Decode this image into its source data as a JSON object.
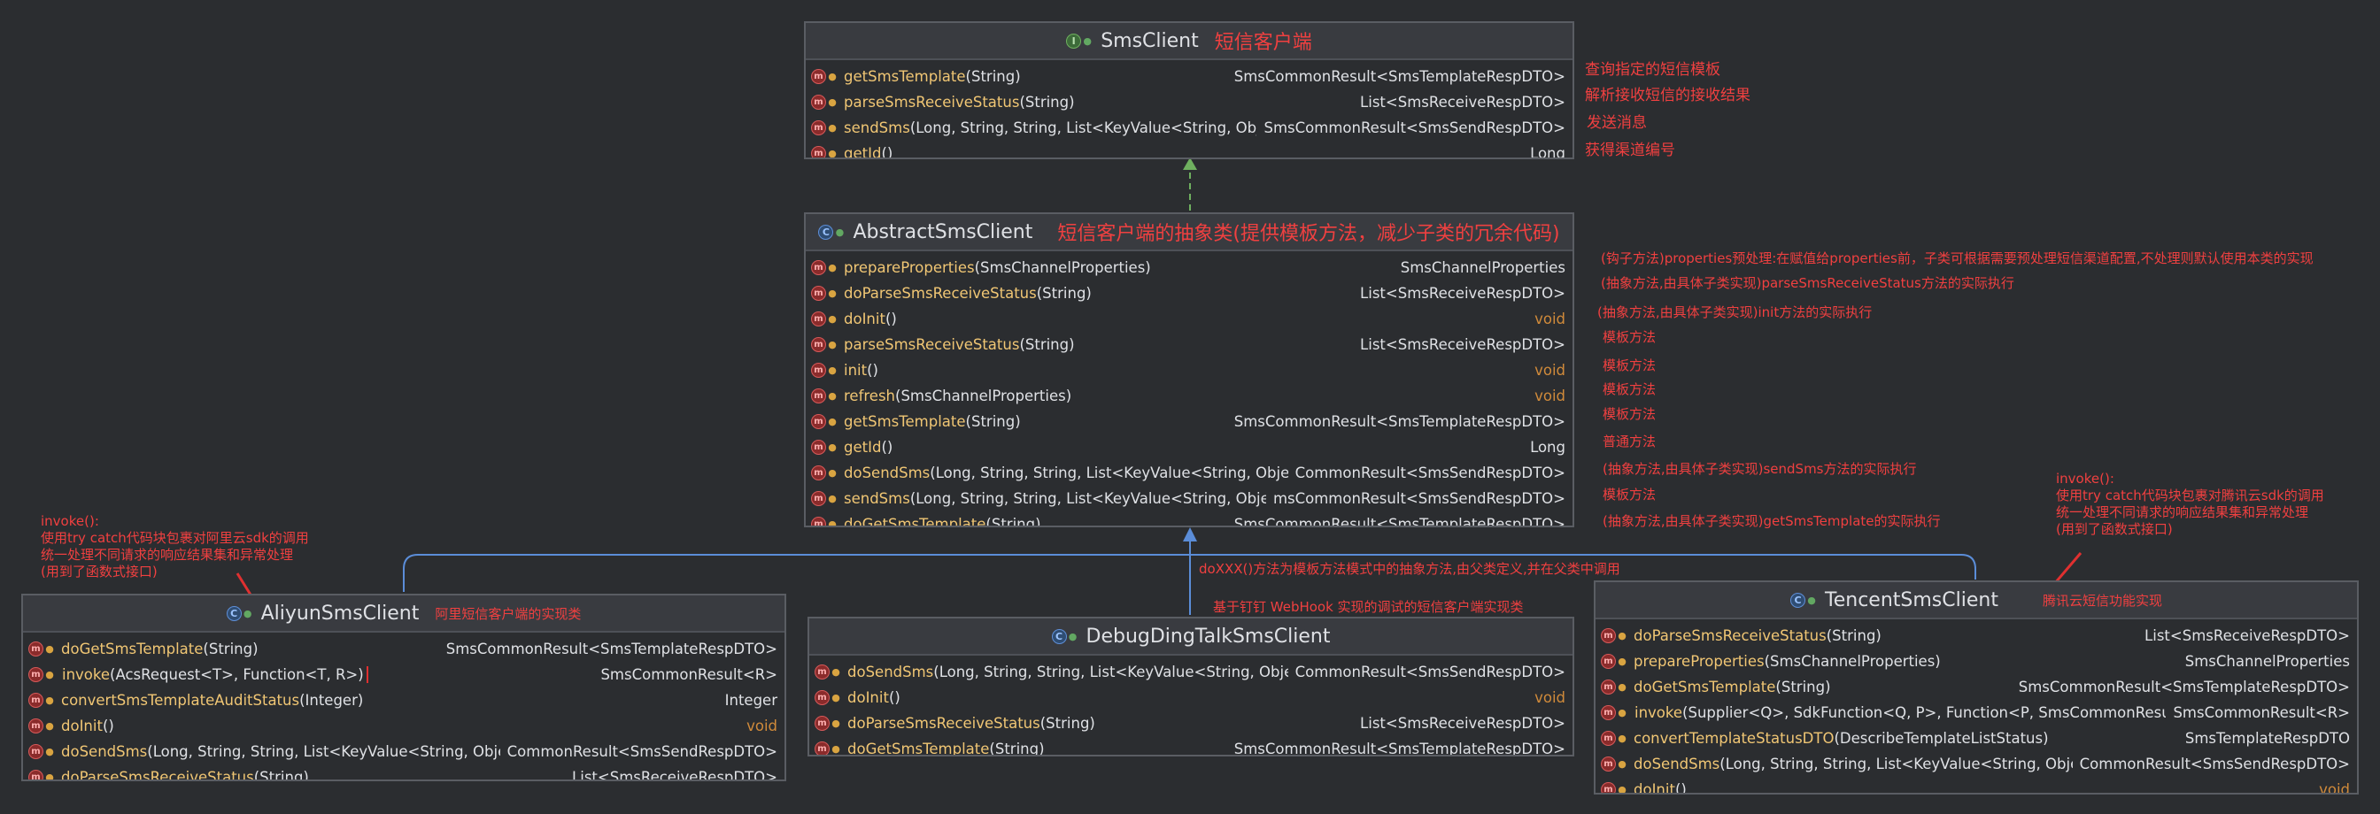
{
  "sms_client": {
    "name": "SmsClient",
    "note": "短信客户端",
    "methods": [
      {
        "name": "getSmsTemplate",
        "params": "(String)",
        "ret": "SmsCommonResult<SmsTemplateRespDTO>",
        "note": "查询指定的短信模板"
      },
      {
        "name": "parseSmsReceiveStatus",
        "params": "(String)",
        "ret": "List<SmsReceiveRespDTO>",
        "note": "解析接收短信的接收结果"
      },
      {
        "name": "sendSms",
        "params": "(Long, String, String, List<KeyValue<String, Object>>)",
        "ret": "SmsCommonResult<SmsSendRespDTO>",
        "note": "发送消息"
      },
      {
        "name": "getId",
        "params": "()",
        "ret": "Long",
        "note": "获得渠道编号"
      }
    ]
  },
  "abstract_client": {
    "name": "AbstractSmsClient",
    "note": "短信客户端的抽象类(提供模板方法，减少子类的冗余代码)",
    "methods": [
      {
        "name": "prepareProperties",
        "params": "(SmsChannelProperties)",
        "ret": "SmsChannelProperties",
        "note": "(钩子方法)properties预处理:在赋值给properties前，子类可根据需要预处理短信渠道配置,不处理则默认使用本类的实现"
      },
      {
        "name": "doParseSmsReceiveStatus",
        "params": "(String)",
        "ret": "List<SmsReceiveRespDTO>",
        "note": "(抽象方法,由具体子类实现)parseSmsReceiveStatus方法的实际执行"
      },
      {
        "name": "doInit",
        "params": "()",
        "ret": "void",
        "note": "(抽象方法,由具体子类实现)init方法的实际执行"
      },
      {
        "name": "parseSmsReceiveStatus",
        "params": "(String)",
        "ret": "List<SmsReceiveRespDTO>",
        "note": "模板方法"
      },
      {
        "name": "init",
        "params": "()",
        "ret": "void",
        "note": "模板方法"
      },
      {
        "name": "refresh",
        "params": "(SmsChannelProperties)",
        "ret": "void",
        "note": "模板方法"
      },
      {
        "name": "getSmsTemplate",
        "params": "(String)",
        "ret": "SmsCommonResult<SmsTemplateRespDTO>",
        "note": "模板方法"
      },
      {
        "name": "getId",
        "params": "()",
        "ret": "Long",
        "note": "普通方法"
      },
      {
        "name": "doSendSms",
        "params": "(Long, String, String, List<KeyValue<String, Object>>)",
        "ret": "CommonResult<SmsSendRespDTO>",
        "note": "(抽象方法,由具体子类实现)sendSms方法的实际执行"
      },
      {
        "name": "sendSms",
        "params": "(Long, String, String, List<KeyValue<String, Object>>)",
        "ret": "msCommonResult<SmsSendRespDTO>",
        "note": "模板方法"
      },
      {
        "name": "doGetSmsTemplate",
        "params": "(String)",
        "ret": "SmsCommonResult<SmsTemplateRespDTO>",
        "note": "(抽象方法,由具体子类实现)getSmsTemplate的实际执行"
      }
    ]
  },
  "aliyun_client": {
    "name": "AliyunSmsClient",
    "note": "阿里短信客户端的实现类",
    "methods": [
      {
        "name": "doGetSmsTemplate",
        "params": "(String)",
        "ret": "SmsCommonResult<SmsTemplateRespDTO>"
      },
      {
        "name": "invoke",
        "params": "(AcsRequest<T>, Function<T, R>)",
        "ret": "SmsCommonResult<R>"
      },
      {
        "name": "convertSmsTemplateAuditStatus",
        "params": "(Integer)",
        "ret": "Integer"
      },
      {
        "name": "doInit",
        "params": "()",
        "ret": "void"
      },
      {
        "name": "doSendSms",
        "params": "(Long, String, String, List<KeyValue<String, Object>>)",
        "ret": "CommonResult<SmsSendRespDTO>"
      },
      {
        "name": "doParseSmsReceiveStatus",
        "params": "(String)",
        "ret": "List<SmsReceiveRespDTO>"
      }
    ],
    "invoke_note": "invoke():\n使用try catch代码块包裹对阿里云sdk的调用\n统一处理不同请求的响应结果集和异常处理\n(用到了函数式接口)"
  },
  "debug_client": {
    "name": "DebugDingTalkSmsClient",
    "note": "基于钉钉 WebHook 实现的调试的短信客户端实现类",
    "methods": [
      {
        "name": "doSendSms",
        "params": "(Long, String, String, List<KeyValue<String, Object>>)",
        "ret": "CommonResult<SmsSendRespDTO>"
      },
      {
        "name": "doInit",
        "params": "()",
        "ret": "void"
      },
      {
        "name": "doParseSmsReceiveStatus",
        "params": "(String)",
        "ret": "List<SmsReceiveRespDTO>"
      },
      {
        "name": "doGetSmsTemplate",
        "params": "(String)",
        "ret": "SmsCommonResult<SmsTemplateRespDTO>"
      }
    ]
  },
  "tencent_client": {
    "name": "TencentSmsClient",
    "note": "腾讯云短信功能实现",
    "methods": [
      {
        "name": "doParseSmsReceiveStatus",
        "params": "(String)",
        "ret": "List<SmsReceiveRespDTO>"
      },
      {
        "name": "prepareProperties",
        "params": "(SmsChannelProperties)",
        "ret": "SmsChannelProperties"
      },
      {
        "name": "doGetSmsTemplate",
        "params": "(String)",
        "ret": "SmsCommonResult<SmsTemplateRespDTO>"
      },
      {
        "name": "invoke",
        "params": "(Supplier<Q>, SdkFunction<Q, P>, Function<P, SmsCommonResult<R>>)",
        "ret": "SmsCommonResult<R>"
      },
      {
        "name": "convertTemplateStatusDTO",
        "params": "(DescribeTemplateListStatus)",
        "ret": "SmsTemplateRespDTO"
      },
      {
        "name": "doSendSms",
        "params": "(Long, String, String, List<KeyValue<String, Object>>)",
        "ret": "CommonResult<SmsSendRespDTO>"
      },
      {
        "name": "doInit",
        "params": "()",
        "ret": "void"
      }
    ],
    "invoke_note": "invoke():\n使用try catch代码块包裹对腾讯云sdk的调用\n统一处理不同请求的响应结果集和异常处理\n(用到了函数式接口)"
  },
  "inheritance_note": "doXXX()方法为模板方法模式中的抽象方法,由父类定义,并在父类中调用",
  "colors": {
    "annotation": "#f04040",
    "method": "#f0c674",
    "void": "#d08a3a",
    "line": "#5b8dd8",
    "dash": "#6fb05f"
  }
}
